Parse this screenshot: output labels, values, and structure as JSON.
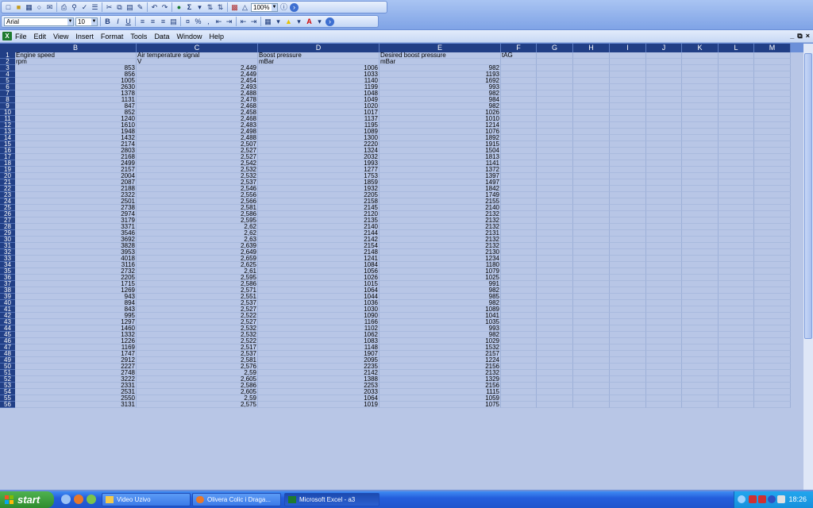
{
  "toolbar": {
    "zoom": "100%",
    "font_name": "Arial",
    "font_size": "10",
    "bold_label": "B",
    "italic_label": "I",
    "underline_label": "U",
    "percent_label": "%",
    "comma_label": ",",
    "sum_label": "Σ"
  },
  "menu": [
    "File",
    "Edit",
    "View",
    "Insert",
    "Format",
    "Tools",
    "Data",
    "Window",
    "Help"
  ],
  "columns": [
    "B",
    "C",
    "D",
    "E",
    "F",
    "G",
    "H",
    "I",
    "J",
    "K",
    "L",
    "M"
  ],
  "header_row1": [
    "Engine speed",
    "Air temperature signal",
    "Boost pressure",
    "Desired boost pressure",
    "tAG"
  ],
  "header_row2": [
    "rpm",
    "V",
    "mBar",
    "mBar"
  ],
  "rows": [
    [
      "3",
      "853",
      "2,449",
      "1006",
      "982"
    ],
    [
      "4",
      "856",
      "2,449",
      "1033",
      "1193"
    ],
    [
      "5",
      "1005",
      "2,454",
      "1140",
      "1692"
    ],
    [
      "6",
      "2630",
      "2,493",
      "1199",
      "993"
    ],
    [
      "7",
      "1378",
      "2,488",
      "1048",
      "982"
    ],
    [
      "8",
      "1131",
      "2,478",
      "1049",
      "984"
    ],
    [
      "9",
      "847",
      "2,468",
      "1020",
      "982"
    ],
    [
      "10",
      "852",
      "2,458",
      "1017",
      "1026"
    ],
    [
      "11",
      "1240",
      "2,468",
      "1137",
      "1010"
    ],
    [
      "12",
      "1610",
      "2,483",
      "1195",
      "1214"
    ],
    [
      "13",
      "1948",
      "2,498",
      "1089",
      "1076"
    ],
    [
      "14",
      "1432",
      "2,488",
      "1300",
      "1892"
    ],
    [
      "15",
      "2174",
      "2,507",
      "2220",
      "1915"
    ],
    [
      "16",
      "2803",
      "2,527",
      "1324",
      "1504"
    ],
    [
      "17",
      "2168",
      "2,527",
      "2032",
      "1813"
    ],
    [
      "18",
      "2499",
      "2,542",
      "1993",
      "1141"
    ],
    [
      "19",
      "2157",
      "2,532",
      "1277",
      "1372"
    ],
    [
      "20",
      "2004",
      "2,532",
      "1753",
      "1397"
    ],
    [
      "21",
      "2087",
      "2,537",
      "1859",
      "1497"
    ],
    [
      "22",
      "2188",
      "2,546",
      "1932",
      "1842"
    ],
    [
      "23",
      "2322",
      "2,556",
      "2205",
      "1749"
    ],
    [
      "24",
      "2501",
      "2,566",
      "2158",
      "2155"
    ],
    [
      "25",
      "2738",
      "2,581",
      "2145",
      "2140"
    ],
    [
      "26",
      "2974",
      "2,586",
      "2120",
      "2132"
    ],
    [
      "27",
      "3179",
      "2,595",
      "2135",
      "2132"
    ],
    [
      "28",
      "3371",
      "2,62",
      "2140",
      "2132"
    ],
    [
      "29",
      "3546",
      "2,62",
      "2144",
      "2131"
    ],
    [
      "30",
      "3692",
      "2,63",
      "2142",
      "2132"
    ],
    [
      "31",
      "3828",
      "2,639",
      "2154",
      "2132"
    ],
    [
      "32",
      "3953",
      "2,649",
      "2148",
      "2130"
    ],
    [
      "33",
      "4018",
      "2,659",
      "1241",
      "1234"
    ],
    [
      "34",
      "3116",
      "2,625",
      "1084",
      "1180"
    ],
    [
      "35",
      "2732",
      "2,61",
      "1056",
      "1079"
    ],
    [
      "36",
      "2205",
      "2,595",
      "1026",
      "1025"
    ],
    [
      "37",
      "1715",
      "2,586",
      "1015",
      "991"
    ],
    [
      "38",
      "1269",
      "2,571",
      "1064",
      "982"
    ],
    [
      "39",
      "943",
      "2,551",
      "1044",
      "985"
    ],
    [
      "40",
      "894",
      "2,537",
      "1036",
      "982"
    ],
    [
      "41",
      "843",
      "2,527",
      "1030",
      "1089"
    ],
    [
      "42",
      "995",
      "2,522",
      "1090",
      "1041"
    ],
    [
      "43",
      "1297",
      "2,527",
      "1166",
      "1035"
    ],
    [
      "44",
      "1460",
      "2,532",
      "1102",
      "993"
    ],
    [
      "45",
      "1332",
      "2,532",
      "1062",
      "982"
    ],
    [
      "46",
      "1226",
      "2,522",
      "1083",
      "1029"
    ],
    [
      "47",
      "1169",
      "2,517",
      "1148",
      "1532"
    ],
    [
      "48",
      "1747",
      "2,537",
      "1907",
      "2157"
    ],
    [
      "49",
      "2912",
      "2,581",
      "2095",
      "1224"
    ],
    [
      "50",
      "2227",
      "2,576",
      "2235",
      "2156"
    ],
    [
      "51",
      "2748",
      "2,59",
      "2142",
      "2132"
    ],
    [
      "52",
      "3222",
      "2,605",
      "1388",
      "1329"
    ],
    [
      "53",
      "2331",
      "2,586",
      "2253",
      "2156"
    ],
    [
      "54",
      "2531",
      "2,605",
      "2033",
      "1115"
    ],
    [
      "55",
      "2550",
      "2,59",
      "1064",
      "1059"
    ],
    [
      "56",
      "3131",
      "2,575",
      "1019",
      "1075"
    ]
  ],
  "taskbar": {
    "start_label": "start",
    "tasks": [
      "Video Uzivo",
      "Olivera Colic i Draga...",
      "Microsoft Excel - a3"
    ],
    "clock": "18:26"
  }
}
